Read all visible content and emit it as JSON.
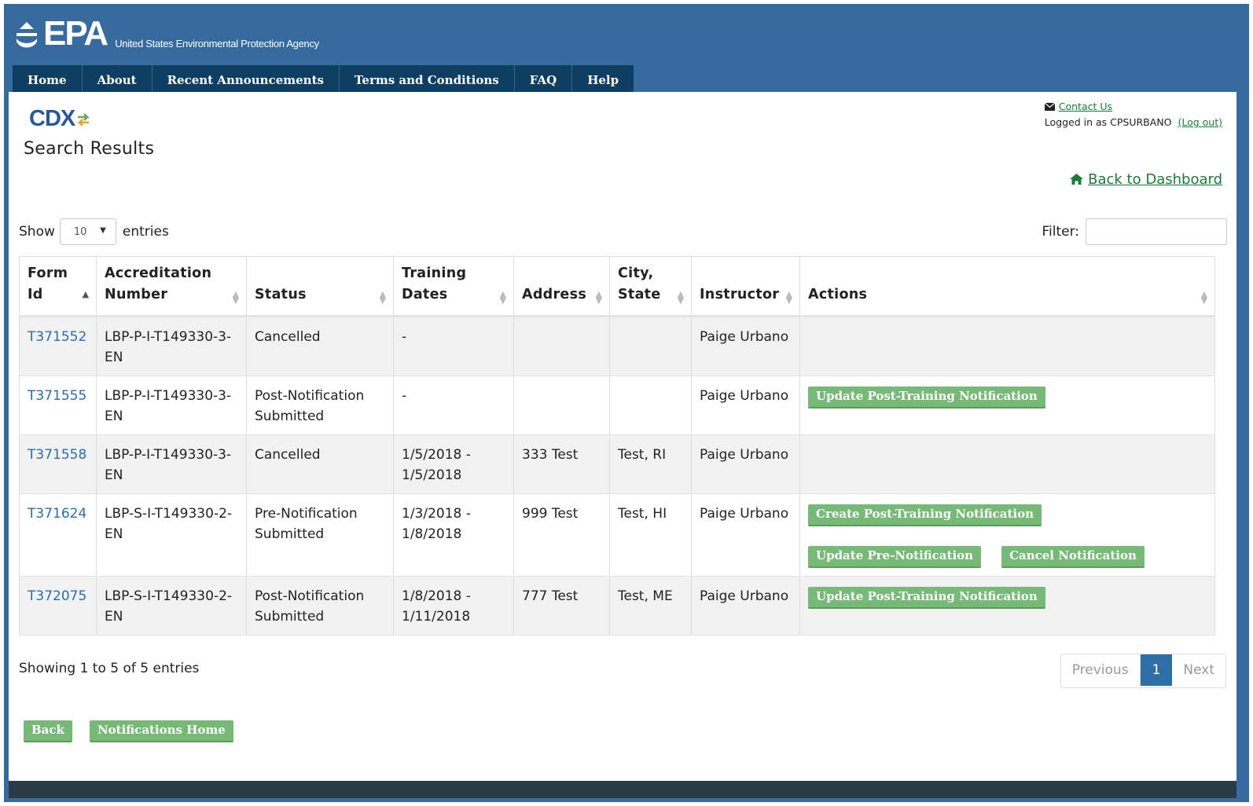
{
  "header": {
    "logo_text": "EPA",
    "agency_name": "United States Environmental Protection Agency",
    "nav": [
      {
        "label": "Home"
      },
      {
        "label": "About"
      },
      {
        "label": "Recent Announcements"
      },
      {
        "label": "Terms and Conditions"
      },
      {
        "label": "FAQ"
      },
      {
        "label": "Help"
      }
    ]
  },
  "brand": {
    "cdx": "CDX"
  },
  "page": {
    "title": "Search Results"
  },
  "user": {
    "contact_label": "Contact Us",
    "logged_in_text": "Logged in as CPSURBANO",
    "logout_label": "(Log out)"
  },
  "dashboard_link": "Back to Dashboard",
  "controls": {
    "show_label": "Show",
    "entries_label": "entries",
    "page_size": "10",
    "filter_label": "Filter:",
    "filter_value": ""
  },
  "table": {
    "columns": [
      {
        "label": "Form Id"
      },
      {
        "label": "Accreditation Number"
      },
      {
        "label": "Status"
      },
      {
        "label": "Training Dates"
      },
      {
        "label": "Address"
      },
      {
        "label": "City, State"
      },
      {
        "label": "Instructor"
      },
      {
        "label": "Actions"
      }
    ],
    "rows": [
      {
        "form_id": "T371552",
        "accreditation": "LBP-P-I-T149330-3-EN",
        "status": "Cancelled",
        "dates": "-",
        "address": "",
        "city_state": "",
        "instructor": "Paige Urbano",
        "actions": []
      },
      {
        "form_id": "T371555",
        "accreditation": "LBP-P-I-T149330-3-EN",
        "status": "Post-Notification Submitted",
        "dates": "-",
        "address": "",
        "city_state": "",
        "instructor": "Paige Urbano",
        "actions": [
          "Update Post-Training Notification"
        ]
      },
      {
        "form_id": "T371558",
        "accreditation": "LBP-P-I-T149330-3-EN",
        "status": "Cancelled",
        "dates": "1/5/2018 - 1/5/2018",
        "address": "333 Test",
        "city_state": "Test, RI",
        "instructor": "Paige Urbano",
        "actions": []
      },
      {
        "form_id": "T371624",
        "accreditation": "LBP-S-I-T149330-2-EN",
        "status": "Pre-Notification Submitted",
        "dates": "1/3/2018 - 1/8/2018",
        "address": "999 Test",
        "city_state": "Test, HI",
        "instructor": "Paige Urbano",
        "actions": [
          "Create Post-Training Notification",
          "Update Pre-Notification",
          "Cancel Notification"
        ]
      },
      {
        "form_id": "T372075",
        "accreditation": "LBP-S-I-T149330-2-EN",
        "status": "Post-Notification Submitted",
        "dates": "1/8/2018 - 1/11/2018",
        "address": "777 Test",
        "city_state": "Test, ME",
        "instructor": "Paige Urbano",
        "actions": [
          "Update Post-Training Notification"
        ]
      }
    ]
  },
  "info": "Showing 1 to 5 of 5 entries",
  "pagination": {
    "previous": "Previous",
    "current": "1",
    "next": "Next"
  },
  "bottom": {
    "back": "Back",
    "notifications_home": "Notifications Home"
  },
  "colors": {
    "header_blue": "#376b9e",
    "nav_dark": "#0e3e62",
    "button_green": "#77b976",
    "link_blue": "#2a6eae",
    "link_green": "#1a7b3a",
    "pager_active": "#2f6fa8"
  },
  "icons": [
    "epa-logo-icon",
    "envelope-icon",
    "home-icon",
    "sort-icon",
    "chevron-down-icon"
  ]
}
